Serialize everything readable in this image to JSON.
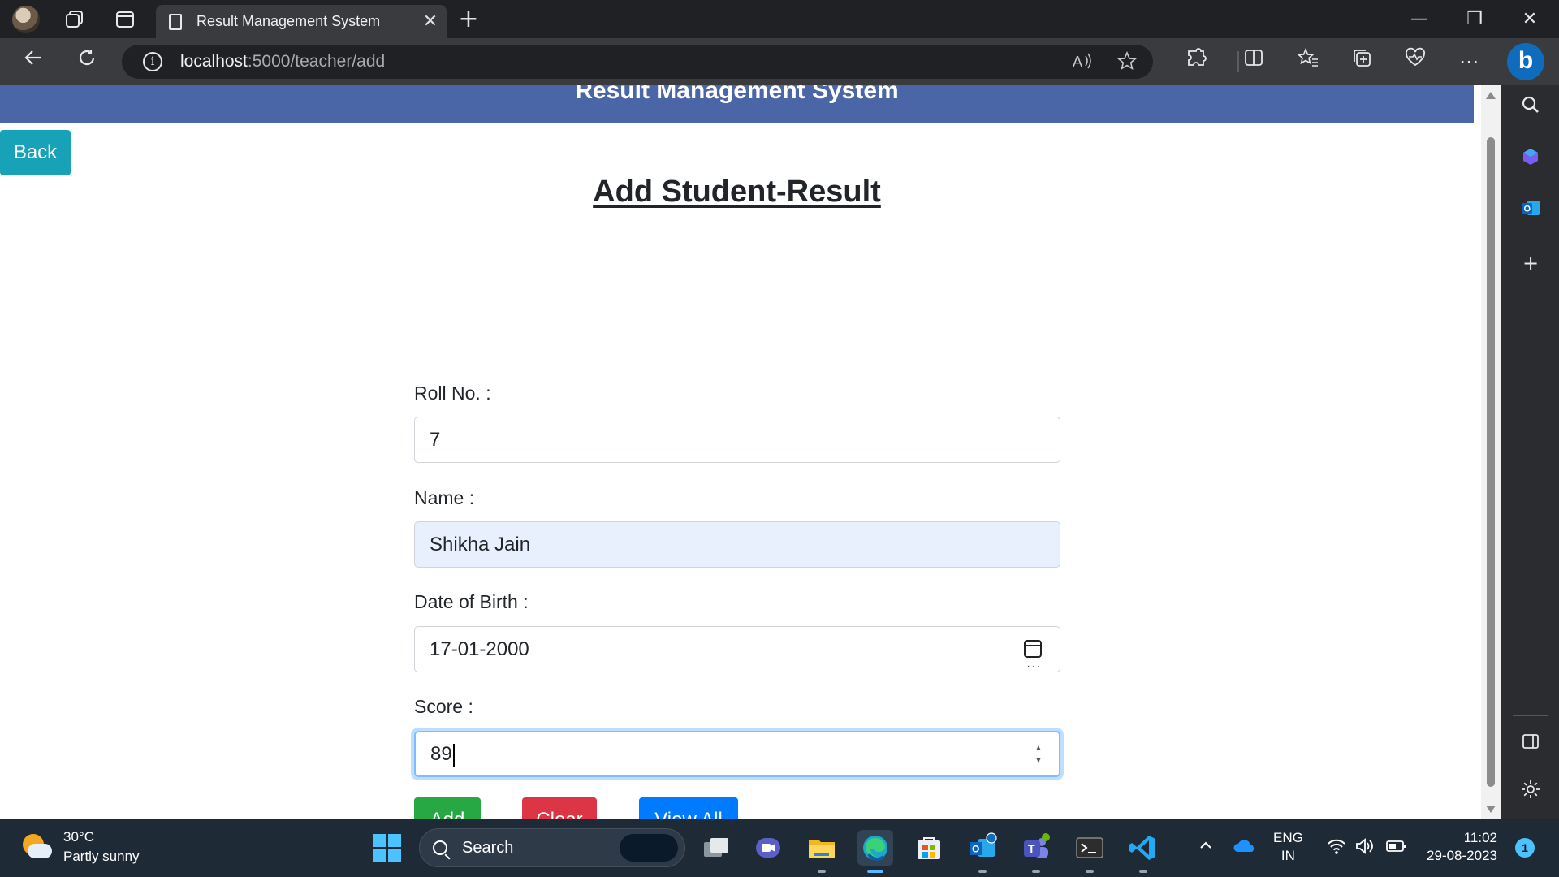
{
  "browser": {
    "tab_title": "Result Management System",
    "tab_close": "✕",
    "new_tab": "+",
    "url_host": "localhost",
    "url_path": ":5000/teacher/add",
    "window_controls": {
      "minimize": "—",
      "restore": "❐",
      "close": "✕"
    }
  },
  "page": {
    "header_title": "Result Management System",
    "back_label": "Back",
    "title": "Add Student-Result",
    "fields": {
      "roll": {
        "label": "Roll No. :",
        "value": "7"
      },
      "name": {
        "label": "Name :",
        "value": "Shikha Jain"
      },
      "dob": {
        "label": "Date of Birth :",
        "value": "17-01-2000"
      },
      "score": {
        "label": "Score :",
        "value": "89"
      }
    },
    "buttons": {
      "add": "Add",
      "clear": "Clear",
      "view_all": "View All"
    },
    "colors": {
      "header": "#4b66a6",
      "back": "#17a2b8",
      "add": "#28a745",
      "clear": "#dc3545",
      "view_all": "#007bff"
    }
  },
  "taskbar": {
    "temperature": "30°C",
    "weather": "Partly sunny",
    "search_label": "Search",
    "language_top": "ENG",
    "language_bottom": "IN",
    "time": "11:02",
    "date": "29-08-2023",
    "notification_count": "1"
  }
}
